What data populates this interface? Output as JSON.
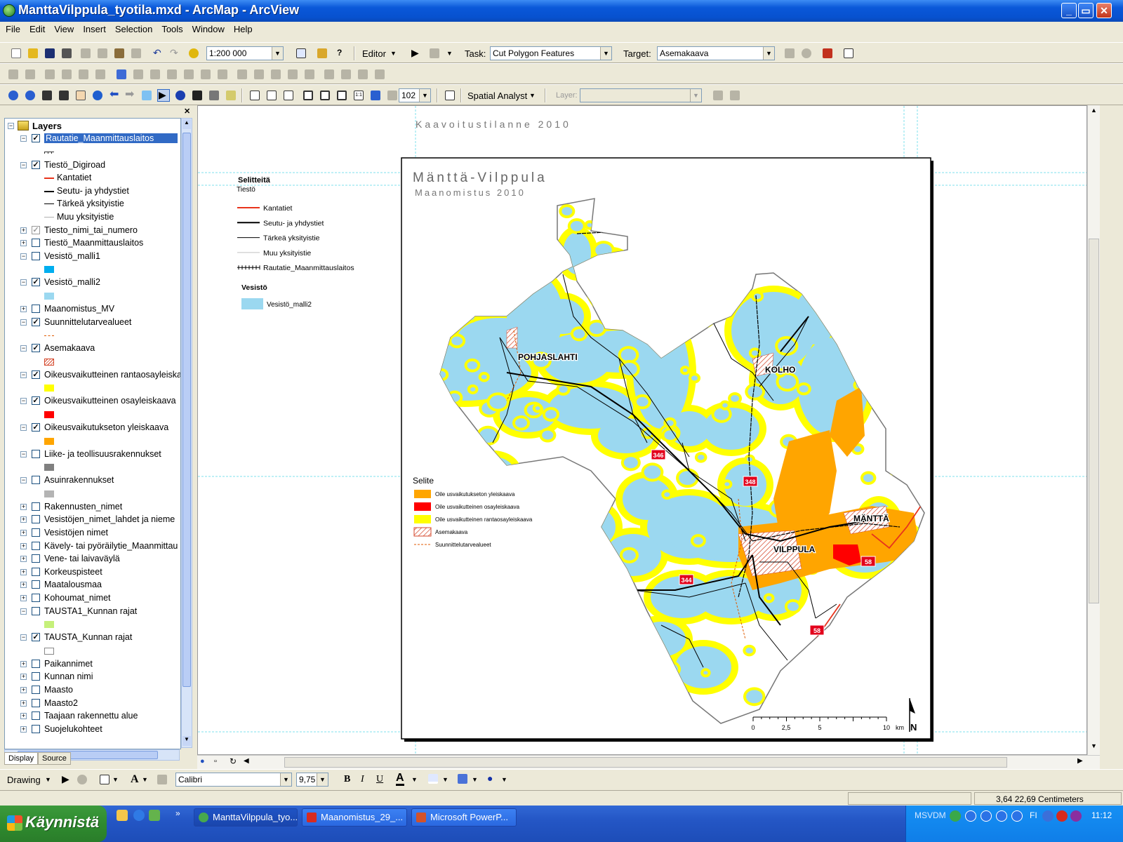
{
  "window": {
    "title": "ManttaVilppula_tyotila.mxd - ArcMap - ArcView",
    "controls": {
      "minimize": "_",
      "maximize": "▭",
      "close": "✕"
    }
  },
  "menu": [
    "File",
    "Edit",
    "View",
    "Insert",
    "Selection",
    "Tools",
    "Window",
    "Help"
  ],
  "standard_toolbar": {
    "scale": "1:200 000",
    "editor_label": "Editor",
    "task_label": "Task:",
    "task_value": "Cut Polygon Features",
    "target_label": "Target:",
    "target_value": "Asemakaava"
  },
  "tools_toolbar": {
    "zoom_value": "102",
    "spatial_analyst_label": "Spatial Analyst",
    "layer_label": "Layer:"
  },
  "toc": {
    "root": "Layers",
    "tabs": [
      "Display",
      "Source"
    ],
    "rows": [
      {
        "type": "layer",
        "label": "Rautatie_Maanmittauslaitos",
        "checked": true,
        "expand": "-",
        "selected": true
      },
      {
        "type": "sym",
        "sym": "rail"
      },
      {
        "type": "layer",
        "label": "Tiestö_Digiroad",
        "checked": true,
        "expand": "-"
      },
      {
        "type": "leg",
        "label": "Kantatiet",
        "sym": "line",
        "color": "#e8341c"
      },
      {
        "type": "leg",
        "label": "Seutu- ja yhdystiet",
        "sym": "line",
        "color": "#000000"
      },
      {
        "type": "leg",
        "label": "Tärkeä yksityistie",
        "sym": "thin",
        "color": "#000000"
      },
      {
        "type": "leg",
        "label": "Muu yksityistie",
        "sym": "thin",
        "color": "#b0b0b0"
      },
      {
        "type": "layer",
        "label": "Tiesto_nimi_tai_numero",
        "checked": true,
        "expand": "+",
        "grey": true
      },
      {
        "type": "layer",
        "label": "Tiestö_Maanmittauslaitos",
        "checked": false,
        "expand": "+"
      },
      {
        "type": "layer",
        "label": "Vesistö_malli1",
        "checked": false,
        "expand": "-"
      },
      {
        "type": "sym",
        "sym": "fill",
        "color": "#00aeef"
      },
      {
        "type": "layer",
        "label": "Vesistö_malli2",
        "checked": true,
        "expand": "-"
      },
      {
        "type": "sym",
        "sym": "fill",
        "color": "#9bd8f0"
      },
      {
        "type": "layer",
        "label": "Maanomistus_MV",
        "checked": false,
        "expand": "+"
      },
      {
        "type": "layer",
        "label": "Suunnittelutarvealueet",
        "checked": true,
        "expand": "-"
      },
      {
        "type": "sym",
        "sym": "dash",
        "color": "#e05a00"
      },
      {
        "type": "layer",
        "label": "Asemakaava",
        "checked": true,
        "expand": "-"
      },
      {
        "type": "sym",
        "sym": "hatch",
        "color": "#d4472b"
      },
      {
        "type": "layer",
        "label": "Oikeusvaikutteinen rantaosayleiskaava",
        "checked": true,
        "expand": "-"
      },
      {
        "type": "sym",
        "sym": "fill",
        "color": "#ffff00"
      },
      {
        "type": "layer",
        "label": "Oikeusvaikutteinen osayleiskaava",
        "checked": true,
        "expand": "-"
      },
      {
        "type": "sym",
        "sym": "fill",
        "color": "#ff0000"
      },
      {
        "type": "layer",
        "label": "Oikeusvaikutukseton yleiskaava",
        "checked": true,
        "expand": "-"
      },
      {
        "type": "sym",
        "sym": "fill",
        "color": "#ffa500"
      },
      {
        "type": "layer",
        "label": "Liike- ja teollisuusrakennukset",
        "checked": false,
        "expand": "-"
      },
      {
        "type": "sym",
        "sym": "fill",
        "color": "#808080"
      },
      {
        "type": "layer",
        "label": "Asuinrakennukset",
        "checked": false,
        "expand": "-"
      },
      {
        "type": "sym",
        "sym": "fill",
        "color": "#b4b4b4"
      },
      {
        "type": "layer",
        "label": "Rakennusten_nimet",
        "checked": false,
        "expand": "+"
      },
      {
        "type": "layer",
        "label": "Vesistöjen_nimet_lahdet ja nieme",
        "checked": false,
        "expand": "+"
      },
      {
        "type": "layer",
        "label": "Vesistöjen nimet",
        "checked": false,
        "expand": "+"
      },
      {
        "type": "layer",
        "label": "Kävely- tai pyöräilytie_Maanmittau",
        "checked": false,
        "expand": "+"
      },
      {
        "type": "layer",
        "label": "Vene- tai laivaväylä",
        "checked": false,
        "expand": "+"
      },
      {
        "type": "layer",
        "label": "Korkeuspisteet",
        "checked": false,
        "expand": "+"
      },
      {
        "type": "layer",
        "label": "Maatalousmaa",
        "checked": false,
        "expand": "+"
      },
      {
        "type": "layer",
        "label": "Kohoumat_nimet",
        "checked": false,
        "expand": "+"
      },
      {
        "type": "layer",
        "label": "TAUSTA1_Kunnan rajat",
        "checked": false,
        "expand": "-"
      },
      {
        "type": "sym",
        "sym": "fill",
        "color": "#c5f07a"
      },
      {
        "type": "layer",
        "label": "TAUSTA_Kunnan rajat",
        "checked": true,
        "expand": "-"
      },
      {
        "type": "sym",
        "sym": "outline",
        "color": "#888888"
      },
      {
        "type": "layer",
        "label": "Paikannimet",
        "checked": false,
        "expand": "+"
      },
      {
        "type": "layer",
        "label": "Kunnan nimi",
        "checked": false,
        "expand": "+"
      },
      {
        "type": "layer",
        "label": "Maasto",
        "checked": false,
        "expand": "+"
      },
      {
        "type": "layer",
        "label": "Maasto2",
        "checked": false,
        "expand": "+"
      },
      {
        "type": "layer",
        "label": "Taajaan rakennettu alue",
        "checked": false,
        "expand": "+"
      },
      {
        "type": "layer",
        "label": "Suojelukohteet",
        "checked": false,
        "expand": "+"
      }
    ]
  },
  "layout": {
    "header": "Kaavoitustilanne 2010",
    "map_title": "Mänttä-Vilppula",
    "map_subtitle": "Maanomistus 2010",
    "legend1": {
      "title": "Selitteitä",
      "group": "Tiestö",
      "items": [
        {
          "label": "Kantatiet",
          "style": "red"
        },
        {
          "label": "Seutu- ja yhdystiet",
          "style": "black-thick"
        },
        {
          "label": "Tärkeä yksityistie",
          "style": "black-thin"
        },
        {
          "label": "Muu yksityistie",
          "style": "grey"
        },
        {
          "label": "Rautatie_Maanmittauslaitos",
          "style": "rail"
        }
      ],
      "water_title": "Vesistö",
      "water_item": "Vesistö_malli2",
      "water_color": "#9bd8f0"
    },
    "legend2": {
      "title": "Selite",
      "items": [
        {
          "label": "Oile usvaikutukseton yleiskaava",
          "color": "#ffa500"
        },
        {
          "label": "Oile usvaikutteinen osayleiskaava",
          "color": "#ff0000"
        },
        {
          "label": "Oile usvaikutteinen rantaosayleiskaava",
          "color": "#ffff00"
        },
        {
          "label": "Asemakaava",
          "color": "hatch"
        },
        {
          "label": "Suunnittelutarvealueet",
          "color": "dash"
        }
      ]
    },
    "places": [
      "POHJASLAHTI",
      "KOLHO",
      "MÄNTTÄ",
      "VILPPULA"
    ],
    "road_numbers": [
      "346",
      "348",
      "344",
      "58",
      "58"
    ],
    "scalebar": {
      "ticks": [
        "0",
        "2,5",
        "5",
        "10"
      ],
      "unit": "km"
    },
    "north": "N"
  },
  "drawing_toolbar": {
    "drawing_label": "Drawing",
    "font": "Calibri",
    "size": "9,75",
    "bold": "B",
    "italic": "I",
    "underline": "U"
  },
  "status": {
    "coords": "3,64  22,69 Centimeters"
  },
  "taskbar": {
    "start_label": "Käynnistä",
    "tasks": [
      "ManttaVilppula_tyo...",
      "Maanomistus_29_...",
      "Microsoft PowerP..."
    ],
    "tray_text": "MSVDM",
    "tray_lang": "FI",
    "clock": "11:12"
  },
  "colors": {
    "water": "#9bd8f0",
    "rantaosayleiskaava": "#ffff00",
    "yleiskaava": "#ffa500",
    "osayleiskaava": "#ff0000",
    "kantatie": "#e8341c"
  }
}
